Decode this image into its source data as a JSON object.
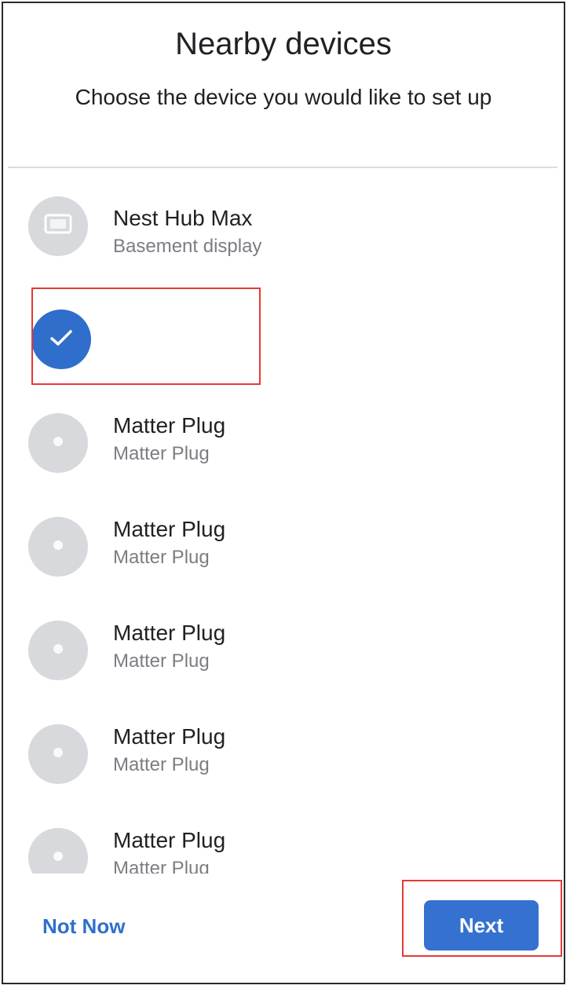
{
  "header": {
    "title": "Nearby devices",
    "subtitle": "Choose the device you would like to set up"
  },
  "devices": [
    {
      "name": "Nest Hub Max",
      "subtitle": "Basement display",
      "icon": "display-icon",
      "selected": false
    },
    {
      "name": "",
      "subtitle": "",
      "icon": "checkmark-icon",
      "selected": true
    },
    {
      "name": "Matter Plug",
      "subtitle": "Matter Plug",
      "icon": "plug-icon",
      "selected": false
    },
    {
      "name": "Matter Plug",
      "subtitle": "Matter Plug",
      "icon": "plug-icon",
      "selected": false
    },
    {
      "name": "Matter Plug",
      "subtitle": "Matter Plug",
      "icon": "plug-icon",
      "selected": false
    },
    {
      "name": "Matter Plug",
      "subtitle": "Matter Plug",
      "icon": "plug-icon",
      "selected": false
    },
    {
      "name": "Matter Plug",
      "subtitle": "Matter Plug",
      "icon": "plug-icon",
      "selected": false
    }
  ],
  "footer": {
    "secondary_label": "Not Now",
    "primary_label": "Next"
  },
  "colors": {
    "accent": "#3571d0",
    "highlight": "#e53935",
    "avatar": "#d7d9dc"
  }
}
